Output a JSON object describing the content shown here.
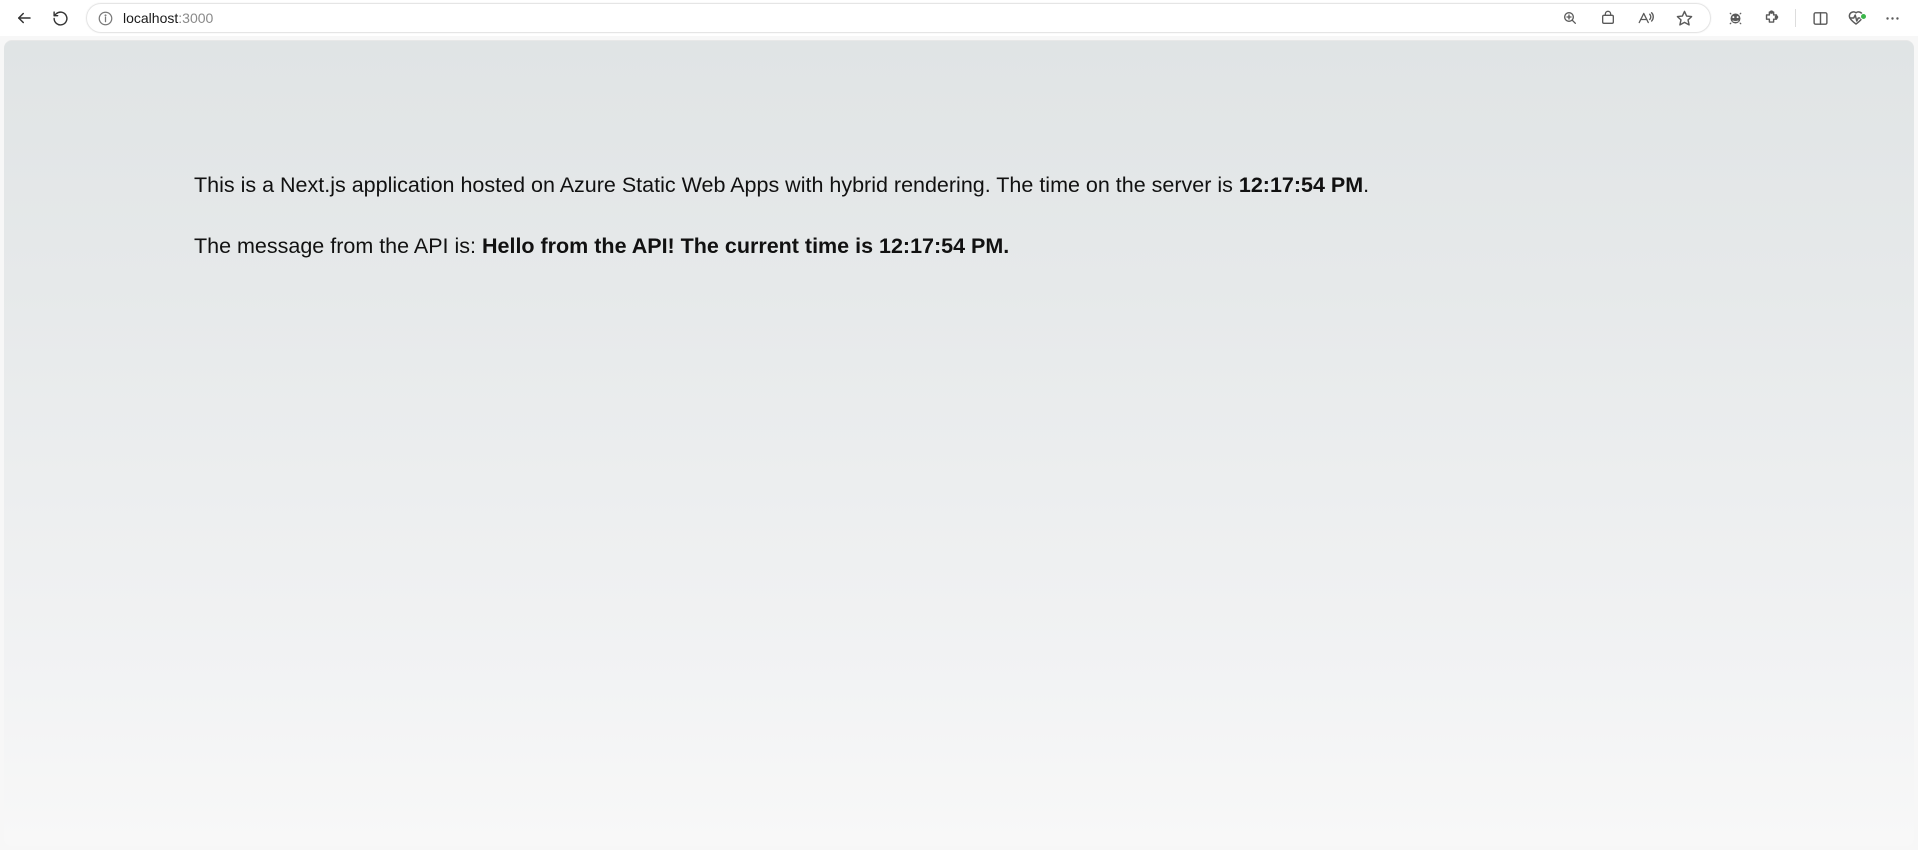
{
  "browser": {
    "url_host": "localhost",
    "url_port": ":3000"
  },
  "page": {
    "line1_prefix": "This is a Next.js application hosted on Azure Static Web Apps with hybrid rendering. The time on the server is ",
    "server_time": "12:17:54 PM",
    "line1_suffix": ".",
    "line2_prefix": "The message from the API is: ",
    "api_message": "Hello from the API! The current time is 12:17:54 PM."
  }
}
